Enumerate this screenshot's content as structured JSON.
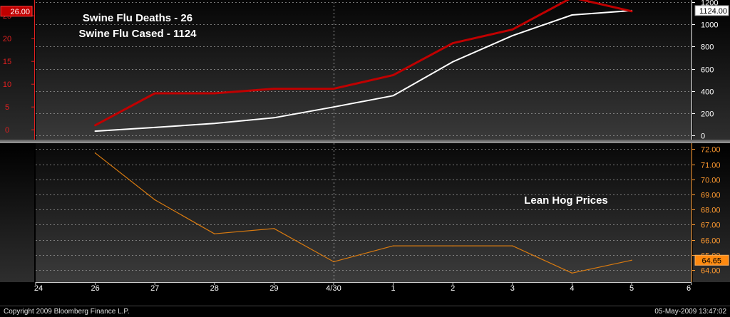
{
  "colors": {
    "deaths": "#c00000",
    "cases": "#ffffff",
    "hog": "#d87a10",
    "left_axis": "#e02020",
    "right_axis": "#ffffff",
    "hog_axis": "#ff9a30",
    "grid": "#9a9a9a"
  },
  "chart_data": [
    {
      "type": "line",
      "x": [
        "26",
        "27",
        "28",
        "29",
        "4/30",
        "1",
        "2",
        "3",
        "4",
        "5"
      ],
      "series": [
        {
          "name": "Swine Flu Deaths",
          "axis": "left",
          "values": [
            1,
            8,
            8,
            9,
            9,
            12,
            19,
            22,
            29,
            26
          ]
        },
        {
          "name": "Swine Flu Cased",
          "axis": "right",
          "values": [
            40,
            73,
            109,
            160,
            257,
            359,
            664,
            898,
            1085,
            1124
          ]
        }
      ],
      "left_ylim": [
        -2,
        28
      ],
      "left_ticks": [
        "0",
        "5",
        "10",
        "15",
        "20",
        "25"
      ],
      "right_ylim": [
        -30,
        1200
      ],
      "right_ticks": [
        "0",
        "200",
        "400",
        "600",
        "800",
        "1000",
        "1200"
      ],
      "grid": true,
      "last_value_labels": {
        "left": "26.00",
        "right": "1124.00"
      },
      "annotations": [
        "Swine Flu Deaths - 26",
        "Swine Flu Cased - 1124"
      ]
    },
    {
      "type": "line",
      "x": [
        "26",
        "27",
        "28",
        "29",
        "4/30",
        "1",
        "2",
        "3",
        "4",
        "5"
      ],
      "series": [
        {
          "name": "Lean Hog Prices",
          "values": [
            71.75,
            68.65,
            66.4,
            66.75,
            64.55,
            65.6,
            65.6,
            65.6,
            63.8,
            64.65
          ]
        }
      ],
      "ylim": [
        63.2,
        72.4
      ],
      "right_ticks": [
        "64.00",
        "65.00",
        "66.00",
        "67.00",
        "68.00",
        "69.00",
        "70.00",
        "71.00",
        "72.00"
      ],
      "grid": true,
      "last_value_label": "64.65",
      "annotation": "Lean Hog Prices"
    }
  ],
  "x_axis_labels": [
    "24",
    "26",
    "27",
    "28",
    "29",
    "4/30",
    "1",
    "2",
    "3",
    "4",
    "5",
    "6"
  ],
  "footer": {
    "copyright": "Copyright 2009 Bloomberg Finance L.P.",
    "timestamp": "05-May-2009 13:47:02"
  }
}
